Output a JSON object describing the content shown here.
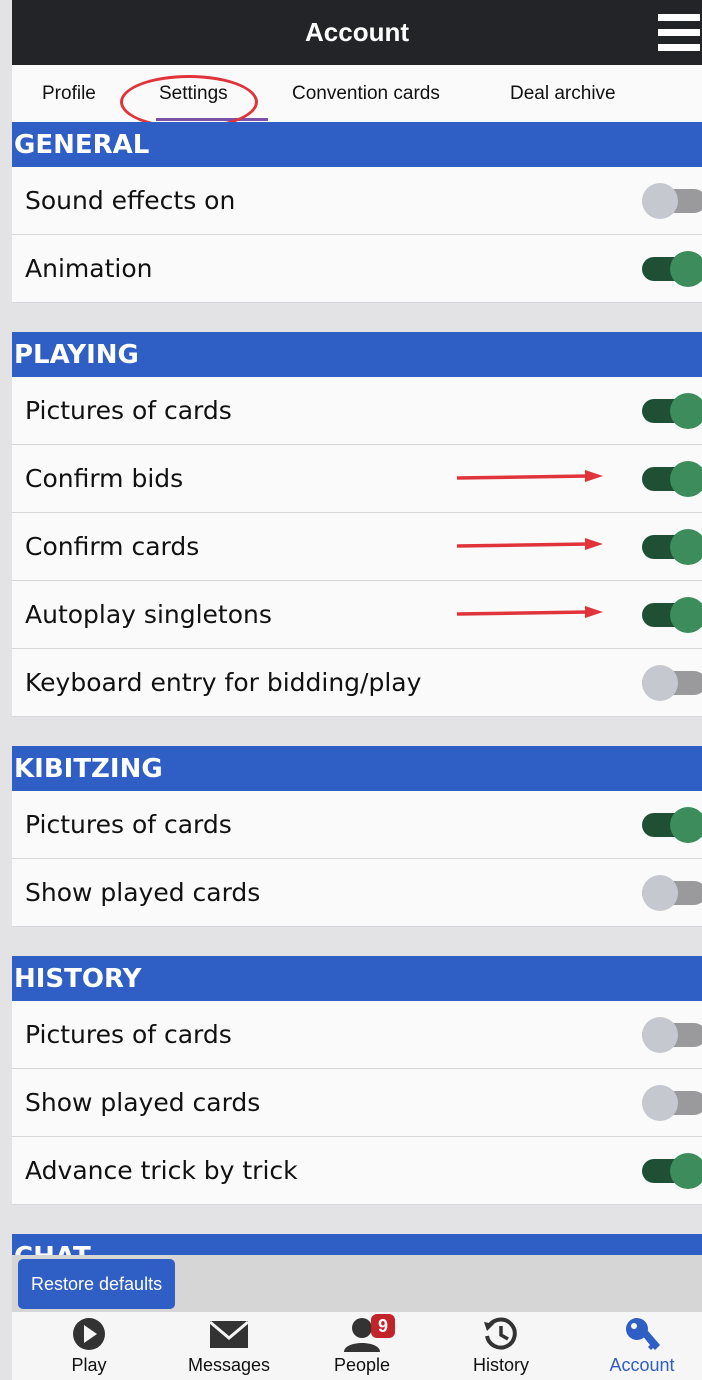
{
  "header": {
    "title": "Account"
  },
  "tabs": [
    {
      "label": "Profile"
    },
    {
      "label": "Settings"
    },
    {
      "label": "Convention cards"
    },
    {
      "label": "Deal archive"
    }
  ],
  "active_tab": "Settings",
  "sections": [
    {
      "title": "GENERAL",
      "items": [
        {
          "label": "Sound effects on",
          "on": false
        },
        {
          "label": "Animation",
          "on": true
        }
      ]
    },
    {
      "title": "PLAYING",
      "items": [
        {
          "label": "Pictures of cards",
          "on": true
        },
        {
          "label": "Confirm bids",
          "on": true
        },
        {
          "label": "Confirm cards",
          "on": true
        },
        {
          "label": "Autoplay singletons",
          "on": true
        },
        {
          "label": "Keyboard entry for bidding/play",
          "on": false
        }
      ]
    },
    {
      "title": "KIBITZING",
      "items": [
        {
          "label": "Pictures of cards",
          "on": true
        },
        {
          "label": "Show played cards",
          "on": false
        }
      ]
    },
    {
      "title": "HISTORY",
      "items": [
        {
          "label": "Pictures of cards",
          "on": false
        },
        {
          "label": "Show played cards",
          "on": false
        },
        {
          "label": "Advance trick by trick",
          "on": true
        }
      ]
    },
    {
      "title": "CHAT",
      "items": []
    }
  ],
  "restore_button": "Restore defaults",
  "nav": [
    {
      "label": "Play",
      "icon": "play-icon"
    },
    {
      "label": "Messages",
      "icon": "envelope-icon"
    },
    {
      "label": "People",
      "icon": "person-icon",
      "badge": "9"
    },
    {
      "label": "History",
      "icon": "history-icon"
    },
    {
      "label": "Account",
      "icon": "key-icon",
      "active": true
    }
  ],
  "colors": {
    "header_bg": "#232427",
    "section_header": "#2f5ec4",
    "toggle_on_track": "#1f4f34",
    "toggle_on_knob": "#3c8c5c",
    "toggle_off_track": "#9a9a9c",
    "toggle_off_knob": "#c6c8cf",
    "annotation_red": "#e0343a",
    "badge": "#c2242a"
  }
}
